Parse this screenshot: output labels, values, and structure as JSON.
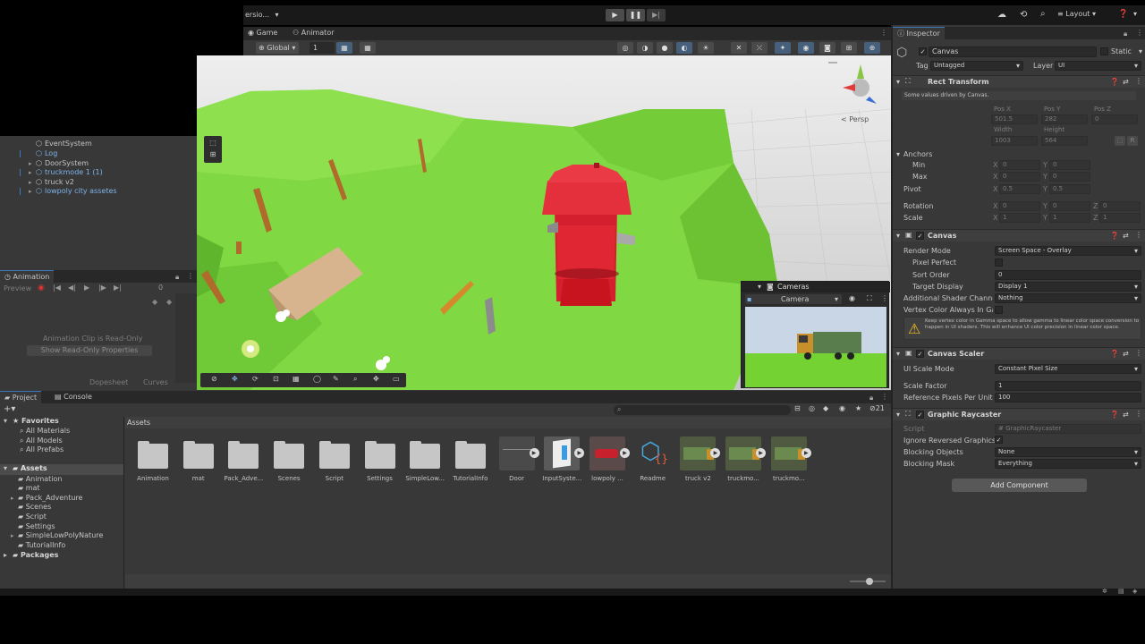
{
  "toolbar": {
    "version_menu": "ersio...",
    "layout_label": "Layout",
    "layout_chevron": "▾",
    "play_icon": "play-icon",
    "pause_icon": "pause-icon",
    "step_icon": "step-icon"
  },
  "scene_tabs": {
    "game": "Game",
    "animator": "Animator"
  },
  "scene_toolbar": {
    "global": "Global",
    "grid_value": "1",
    "persp": "< Persp"
  },
  "hierarchy": {
    "items": [
      {
        "label": "EventSystem",
        "color": "#c4c4c4"
      },
      {
        "label": "Log",
        "color": "#7fb4ea"
      },
      {
        "label": "DoorSystem",
        "color": "#c4c4c4"
      },
      {
        "label": "truckmode 1 (1)",
        "color": "#7fb4ea"
      },
      {
        "label": "truck v2",
        "color": "#c4c4c4"
      },
      {
        "label": "lowpoly city assetes",
        "color": "#7fb4ea"
      }
    ]
  },
  "animation": {
    "tab": "Animation",
    "preview": "Preview",
    "frame": "0",
    "readonly_msg": "Animation Clip is Read-Only",
    "show_readonly_btn": "Show Read-Only Properties",
    "dopesheet": "Dopesheet",
    "curves": "Curves"
  },
  "camera_preview": {
    "title": "Cameras",
    "camera_select": "Camera"
  },
  "project": {
    "tab_project": "Project",
    "tab_console": "Console",
    "favorites_label": "Favorites",
    "favorites": [
      "All Materials",
      "All Models",
      "All Prefabs"
    ],
    "assets_label": "Assets",
    "asset_folders": [
      "Animation",
      "mat",
      "Pack_Adventure",
      "Scenes",
      "Script",
      "Settings",
      "SimpleLowPolyNature",
      "TutorialInfo"
    ],
    "packages_label": "Packages",
    "breadcrumb": "Assets",
    "badge_count": "21",
    "grid_folders": [
      "Animation",
      "mat",
      "Pack_Adve...",
      "Scenes",
      "Script",
      "Settings",
      "SimpleLow...",
      "TutorialInfo"
    ],
    "grid_assets": [
      "Door",
      "InputSyste...",
      "lowpoly ...",
      "Readme",
      "truck v2",
      "truckmo...",
      "truckmo..."
    ]
  },
  "inspector": {
    "tab": "Inspector",
    "object_name": "Canvas",
    "static_label": "Static",
    "tag_label": "Tag",
    "tag_value": "Untagged",
    "layer_label": "Layer",
    "layer_value": "UI",
    "rect_transform": {
      "title": "Rect Transform",
      "note": "Some values driven by Canvas.",
      "pos_x_label": "Pos X",
      "pos_y_label": "Pos Y",
      "pos_z_label": "Pos Z",
      "pos_x": "501.5",
      "pos_y": "282",
      "pos_z": "0",
      "width_label": "Width",
      "height_label": "Height",
      "width": "1003",
      "height": "564",
      "anchors": "Anchors",
      "min": "Min",
      "max": "Max",
      "min_x": "0",
      "min_y": "0",
      "max_x": "0",
      "max_y": "0",
      "pivot": "Pivot",
      "pivot_x": "0.5",
      "pivot_y": "0.5",
      "rotation": "Rotation",
      "rot_x": "0",
      "rot_y": "0",
      "rot_z": "0",
      "scale": "Scale",
      "scale_x": "1",
      "scale_y": "1",
      "scale_z": "1",
      "axis_x": "X",
      "axis_y": "Y",
      "axis_z": "Z",
      "r_btn": "R"
    },
    "canvas": {
      "title": "Canvas",
      "render_mode_label": "Render Mode",
      "render_mode": "Screen Space - Overlay",
      "pixel_perfect": "Pixel Perfect",
      "sort_order_label": "Sort Order",
      "sort_order": "0",
      "target_display_label": "Target Display",
      "target_display": "Display 1",
      "additional_shader_label": "Additional Shader Channels",
      "additional_shader": "Nothing",
      "vertex_color_label": "Vertex Color Always In Gamma",
      "warning": "Keep vertex color in Gamma space to allow gamma to linear color space conversion to happen in UI shaders. This will enhance UI color precision in linear color space."
    },
    "canvas_scaler": {
      "title": "Canvas Scaler",
      "ui_scale_label": "UI Scale Mode",
      "ui_scale": "Constant Pixel Size",
      "scale_factor_label": "Scale Factor",
      "scale_factor": "1",
      "ref_ppu_label": "Reference Pixels Per Unit",
      "ref_ppu": "100"
    },
    "graphic_raycaster": {
      "title": "Graphic Raycaster",
      "script_label": "Script",
      "script_value": "GraphicRaycaster",
      "ignore_reversed_label": "Ignore Reversed Graphics",
      "blocking_objects_label": "Blocking Objects",
      "blocking_objects": "None",
      "blocking_mask_label": "Blocking Mask",
      "blocking_mask": "Everything"
    },
    "add_component": "Add Component"
  },
  "colors": {
    "accent": "#3a79bb",
    "selected_blue": "#7fb4ea",
    "hydrant_red": "#d4202e",
    "grass": "#7dd63c"
  }
}
